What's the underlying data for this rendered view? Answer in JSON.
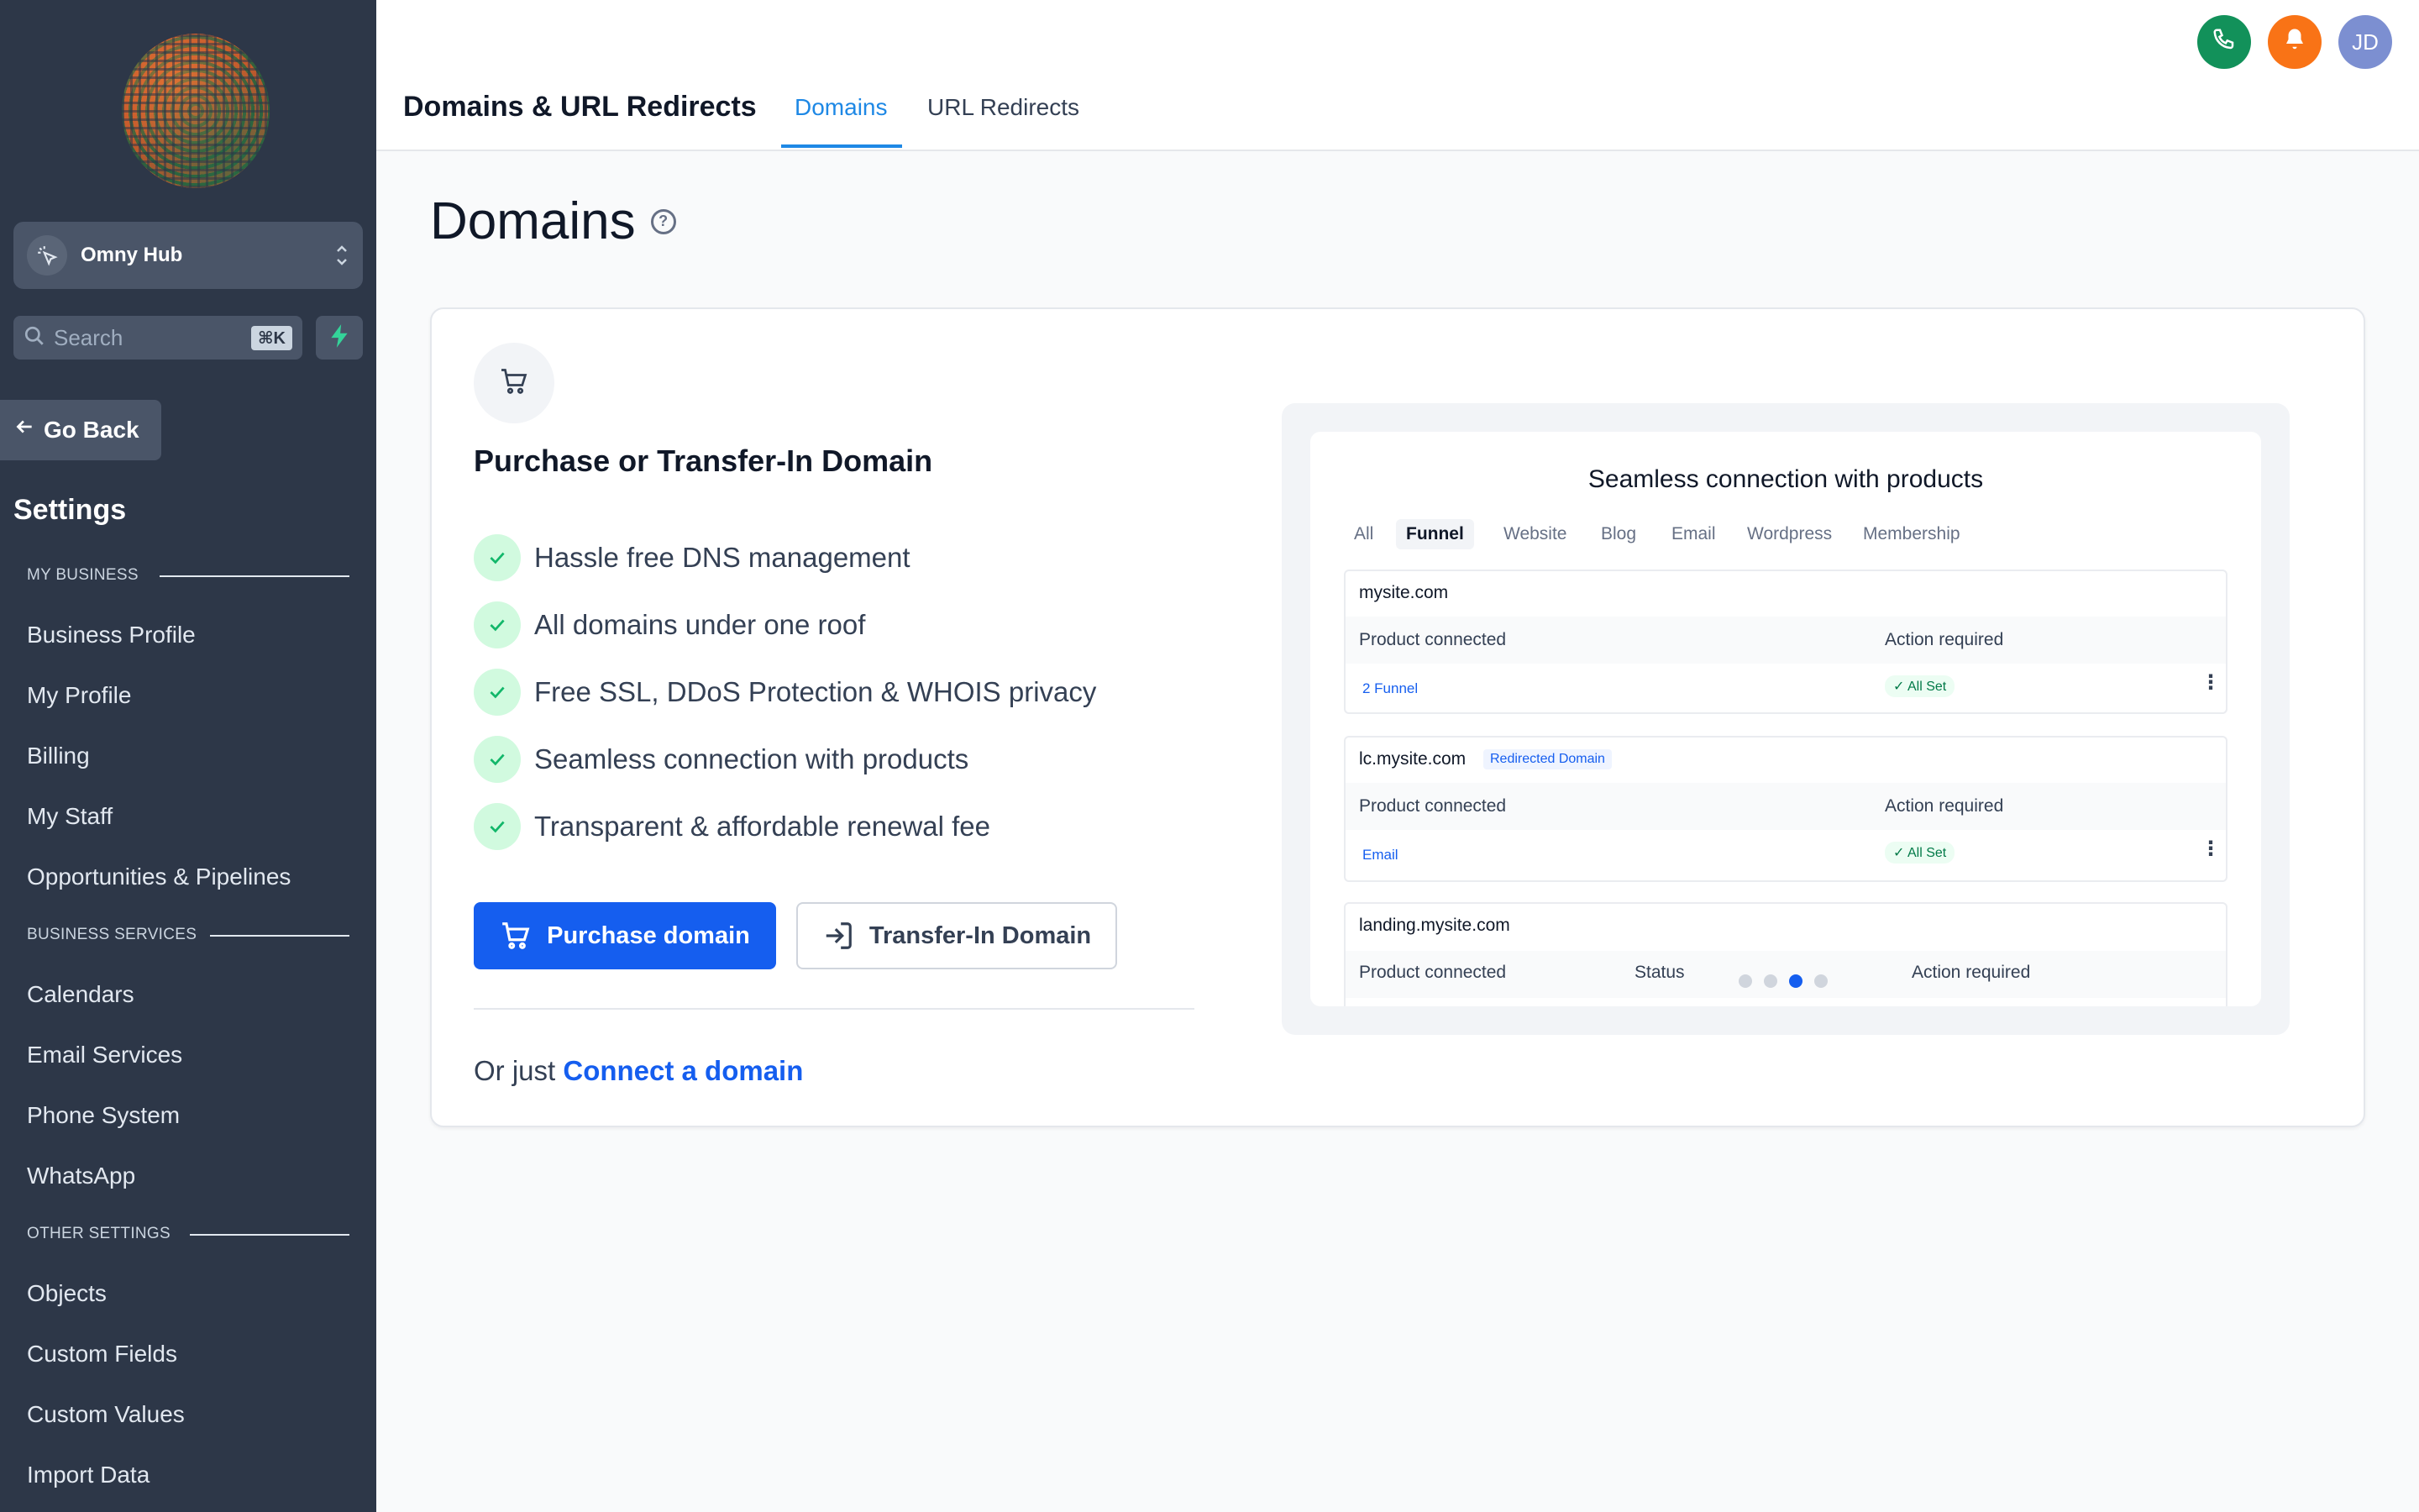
{
  "sidebar": {
    "account_name": "Omny Hub",
    "search_placeholder": "Search",
    "search_shortcut": "⌘K",
    "go_back_label": "Go Back",
    "settings_title": "Settings",
    "sections": [
      {
        "label": "MY BUSINESS",
        "items": [
          "Business Profile",
          "My Profile",
          "Billing",
          "My Staff",
          "Opportunities & Pipelines"
        ]
      },
      {
        "label": "BUSINESS SERVICES",
        "items": [
          "Calendars",
          "Email Services",
          "Phone System",
          "WhatsApp"
        ]
      },
      {
        "label": "OTHER SETTINGS",
        "items": [
          "Objects",
          "Custom Fields",
          "Custom Values",
          "Import Data"
        ]
      }
    ]
  },
  "topbar": {
    "title": "Domains & URL Redirects",
    "tabs": [
      {
        "label": "Domains",
        "active": true
      },
      {
        "label": "URL Redirects",
        "active": false
      }
    ],
    "icons": [
      {
        "name": "phone-icon",
        "color": "#12915a"
      },
      {
        "name": "bell-icon",
        "color": "#f97316"
      }
    ],
    "avatar_initials": "JD",
    "avatar_color": "#7c8fd1"
  },
  "main": {
    "page_title": "Domains",
    "card": {
      "heading": "Purchase or Transfer-In Domain",
      "features": [
        "Hassle free DNS management",
        "All domains under one roof",
        "Free SSL, DDoS Protection & WHOIS privacy",
        "Seamless connection with products",
        "Transparent & affordable renewal fee"
      ],
      "purchase_button": "Purchase domain",
      "transfer_button": "Transfer-In Domain",
      "connect_prefix": "Or just",
      "connect_link": "Connect a domain"
    },
    "preview": {
      "title": "Seamless connection with products",
      "tabs": [
        "All",
        "Funnel",
        "Website",
        "Blog",
        "Email",
        "Wordpress",
        "Membership"
      ],
      "active_tab": "Funnel",
      "domains": [
        {
          "name": "mysite.com",
          "badge": "",
          "col1": "Product connected",
          "col2": "Action required",
          "product": "2 Funnel",
          "status": "All Set"
        },
        {
          "name": "lc.mysite.com",
          "badge": "Redirected Domain",
          "col1": "Product connected",
          "col2": "Action required",
          "product": "Email",
          "status": "All Set"
        },
        {
          "name": "landing.mysite.com",
          "badge": "",
          "col1": "Product connected",
          "col_status": "Status",
          "col2": "Action required"
        }
      ],
      "carousel_active_index": 2,
      "carousel_count": 4
    }
  },
  "colors": {
    "sidebar_bg": "#2d3748",
    "primary": "#155eef",
    "tab_active": "#1e88e5",
    "check_bg": "#d1fadf",
    "check_color": "#12b76a"
  }
}
